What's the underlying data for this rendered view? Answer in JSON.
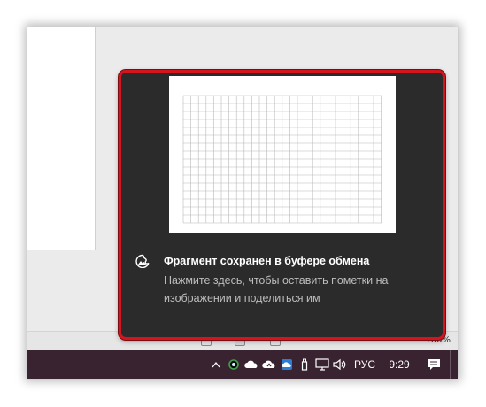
{
  "taskbar": {
    "tray_icons": [
      "chevron-up-icon",
      "app-dot-icon",
      "cloud-icon",
      "cloud-upload-icon",
      "onedrive-icon",
      "usb-drive-icon",
      "network-icon",
      "volume-icon"
    ],
    "language": "РУС",
    "clock": "9:29",
    "color": "#3a2330"
  },
  "statusbar": {
    "zoom": "100%"
  },
  "toast": {
    "title": "Фрагмент сохранен в буфере обмена",
    "body": "Нажмите здесь, чтобы оставить пометки на изображении и поделиться им",
    "border_color": "#d4151f",
    "background": "#2b2b2b",
    "icon": "snip-sketch-icon"
  }
}
